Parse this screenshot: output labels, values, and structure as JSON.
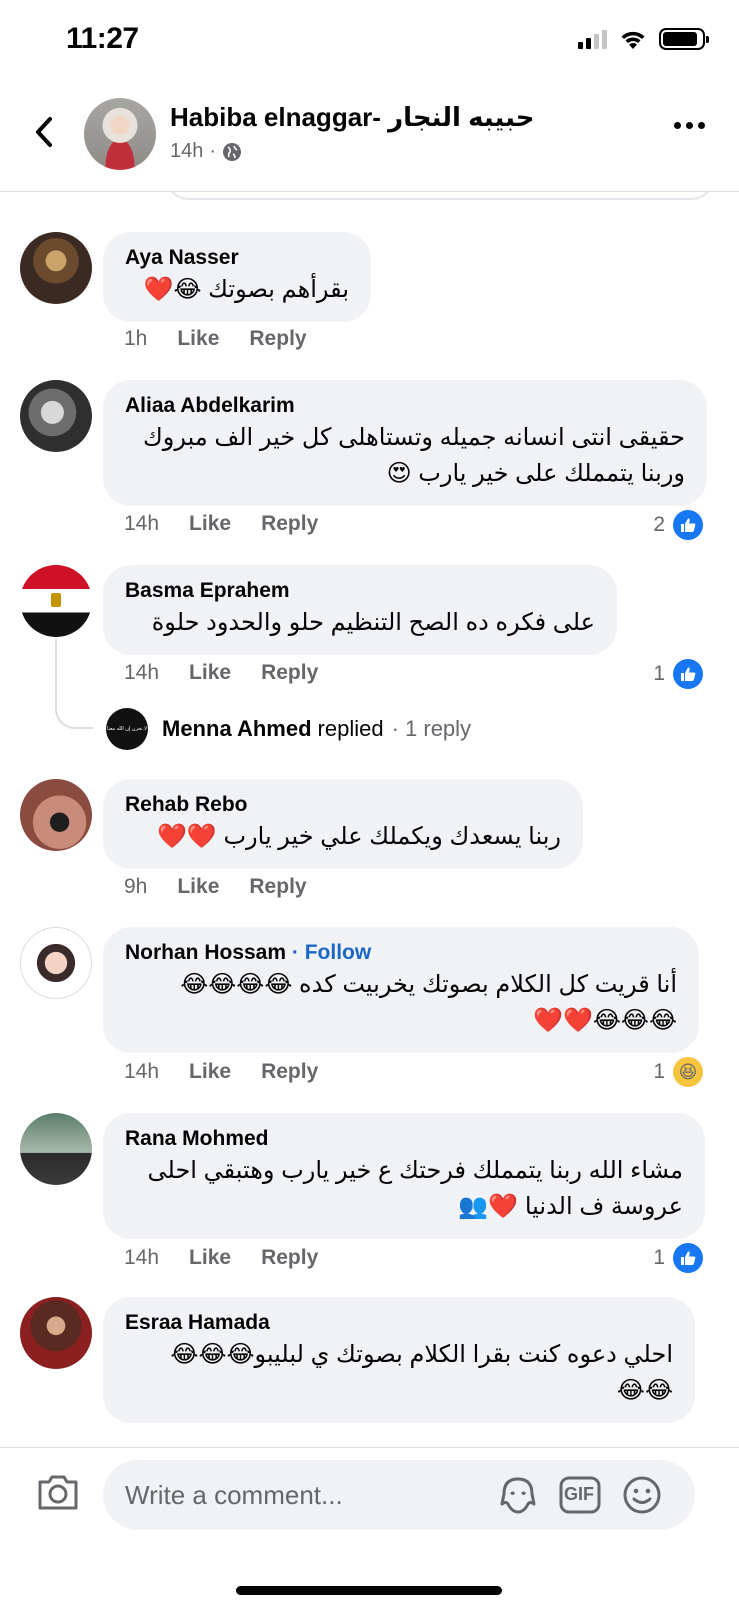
{
  "status_bar": {
    "time": "11:27"
  },
  "header": {
    "title": "Habiba elnaggar- حبيبه النجار",
    "time_ago": "14h",
    "meta_separator": "·"
  },
  "comments": [
    {
      "author": "Aya Nasser",
      "follow": "",
      "text": "بقرأهم بصوتك 😂❤️",
      "time": "1h",
      "like_label": "Like",
      "reply_label": "Reply",
      "reaction_count": "",
      "reaction_type": ""
    },
    {
      "author": "Aliaa Abdelkarim",
      "follow": "",
      "text": "حقيقى انتى انسانه جميله وتستاهلى كل خير الف مبروك\nوربنا يتمملك على خير يارب 😍",
      "time": "14h",
      "like_label": "Like",
      "reply_label": "Reply",
      "reaction_count": "2",
      "reaction_type": "like"
    },
    {
      "author": "Basma Eprahem",
      "follow": "",
      "text": "على فكره ده الصح التنظيم حلو والحدود حلوة",
      "time": "14h",
      "like_label": "Like",
      "reply_label": "Reply",
      "reaction_count": "1",
      "reaction_type": "like"
    },
    {
      "author": "Rehab Rebo",
      "follow": "",
      "text": "ربنا يسعدك ويكملك علي خير يارب ❤️❤️",
      "time": "9h",
      "like_label": "Like",
      "reply_label": "Reply",
      "reaction_count": "",
      "reaction_type": ""
    },
    {
      "author": "Norhan Hossam",
      "follow": "· Follow",
      "text": "أنا قريت كل الكلام بصوتك يخربيت كده 😂😂😂😂\n😂😂😂❤️❤️",
      "time": "14h",
      "like_label": "Like",
      "reply_label": "Reply",
      "reaction_count": "1",
      "reaction_type": "haha"
    },
    {
      "author": "Rana Mohmed",
      "follow": "",
      "text": "مشاء الله ربنا يتمملك فرحتك ع خير يارب وهتبقي احلى\nعروسة ف الدنيا ❤️👥",
      "time": "14h",
      "like_label": "Like",
      "reply_label": "Reply",
      "reaction_count": "1",
      "reaction_type": "like"
    },
    {
      "author": "Esraa Hamada",
      "follow": "",
      "text": "احلي دعوه كنت بقرا الكلام بصوتك ي لبليبو😂😂😂\n😂😂",
      "time": "",
      "like_label": "",
      "reply_label": "",
      "reaction_count": "",
      "reaction_type": ""
    }
  ],
  "reply_thread": {
    "name": "Menna Ahmed",
    "verb": "replied",
    "count": "· 1 reply",
    "avatar_text": "لا تحزن إن الله معنا"
  },
  "composer": {
    "placeholder": "Write a comment...",
    "gif_label": "GIF"
  },
  "icons": {
    "back": "chevron-left-icon",
    "privacy": "globe-icon",
    "more": "more-horizontal-icon",
    "camera": "camera-icon",
    "avatar_sticker": "avatar-sticker-icon",
    "gif": "gif-icon",
    "emoji": "smiley-icon",
    "like": "thumbs-up-icon",
    "haha": "haha-reaction-icon"
  },
  "colors": {
    "bubble": "#f0f2f5",
    "secondary_text": "#65676b",
    "like_blue": "#1877f2",
    "follow_blue": "#1b66c9"
  }
}
